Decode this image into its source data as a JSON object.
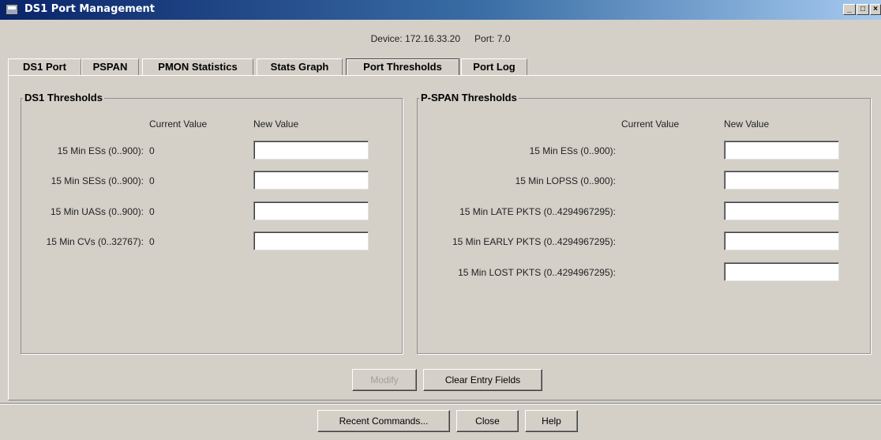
{
  "window": {
    "title": "DS1 Port Management",
    "minimize": "_",
    "maximize": "□",
    "close": "×"
  },
  "device": {
    "text": "Device: 172.16.33.20",
    "port": "Port: 7.0"
  },
  "tabs": [
    "DS1 Port",
    "PSPAN",
    "PMON Statistics",
    "Stats Graph",
    "Port Thresholds",
    "Port Log"
  ],
  "active_tab": "Port Thresholds",
  "ds1": {
    "title": "DS1 Thresholds",
    "current_header": "Current Value",
    "new_header": "New Value",
    "rows": [
      {
        "label": "15 Min ESs (0..900):",
        "current": "0",
        "new": ""
      },
      {
        "label": "15 Min SESs (0..900):",
        "current": "0",
        "new": ""
      },
      {
        "label": "15 Min UASs (0..900):",
        "current": "0",
        "new": ""
      },
      {
        "label": "15 Min CVs (0..32767):",
        "current": "0",
        "new": ""
      }
    ]
  },
  "pspan": {
    "title": "P-SPAN Thresholds",
    "current_header": "Current Value",
    "new_header": "New Value",
    "rows": [
      {
        "label": "15 Min ESs (0..900):",
        "new": ""
      },
      {
        "label": "15 Min LOPSS (0..900):",
        "new": ""
      },
      {
        "label": "15 Min LATE PKTS (0..4294967295):",
        "new": ""
      },
      {
        "label": "15 Min EARLY PKTS (0..4294967295):",
        "new": ""
      },
      {
        "label": "15 Min LOST PKTS (0..4294967295):",
        "new": ""
      }
    ]
  },
  "actions": {
    "modify": "Modify",
    "clear": "Clear Entry Fields"
  },
  "footer": {
    "recent": "Recent Commands...",
    "close": "Close",
    "help": "Help"
  }
}
